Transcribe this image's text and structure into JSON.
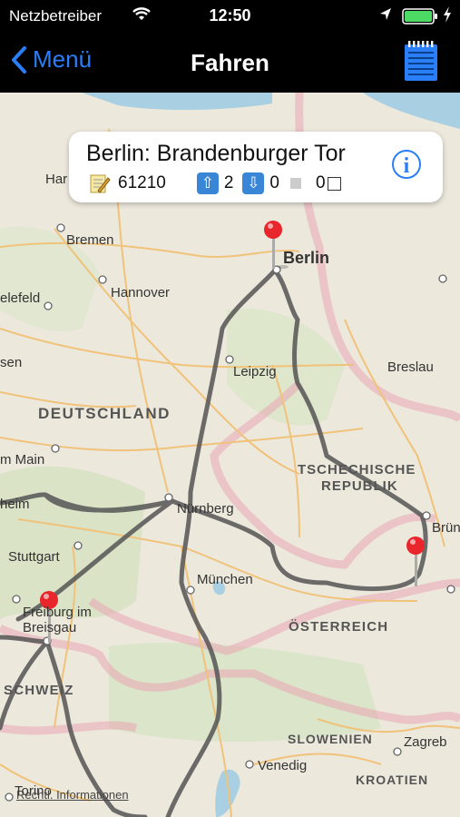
{
  "status_bar": {
    "carrier": "Netzbetreiber",
    "time": "12:50"
  },
  "nav": {
    "back_label": "Menü",
    "title": "Fahren",
    "list_icon": "list-icon"
  },
  "callout": {
    "title": "Berlin: Brandenburger Tor",
    "number": "61210",
    "up_count": "2",
    "down_count": "0",
    "gray_count": "0"
  },
  "map": {
    "labels": [
      {
        "text": "Berlin"
      },
      {
        "text": "Bremen"
      },
      {
        "text": "Hannover"
      },
      {
        "text": "elefeld"
      },
      {
        "text": "sen"
      },
      {
        "text": "Leipzig"
      },
      {
        "text": "Breslau"
      },
      {
        "text": "DEUTSCHLAND"
      },
      {
        "text": "m Main"
      },
      {
        "text": "TSCHECHISCHE"
      },
      {
        "text": "REPUBLIK"
      },
      {
        "text": "heim"
      },
      {
        "text": "Nürnberg"
      },
      {
        "text": "Brün"
      },
      {
        "text": "Stuttgart"
      },
      {
        "text": "München"
      },
      {
        "text": "Freiburg im"
      },
      {
        "text": "Breisgau"
      },
      {
        "text": "ÖSTERREICH"
      },
      {
        "text": "SCHWEIZ"
      },
      {
        "text": "SLOWENIEN"
      },
      {
        "text": "Zagreb"
      },
      {
        "text": "Venedig"
      },
      {
        "text": "KROATIEN"
      },
      {
        "text": "Torino"
      },
      {
        "text": "Har"
      }
    ],
    "legal": "Rechtl. Informationen"
  }
}
